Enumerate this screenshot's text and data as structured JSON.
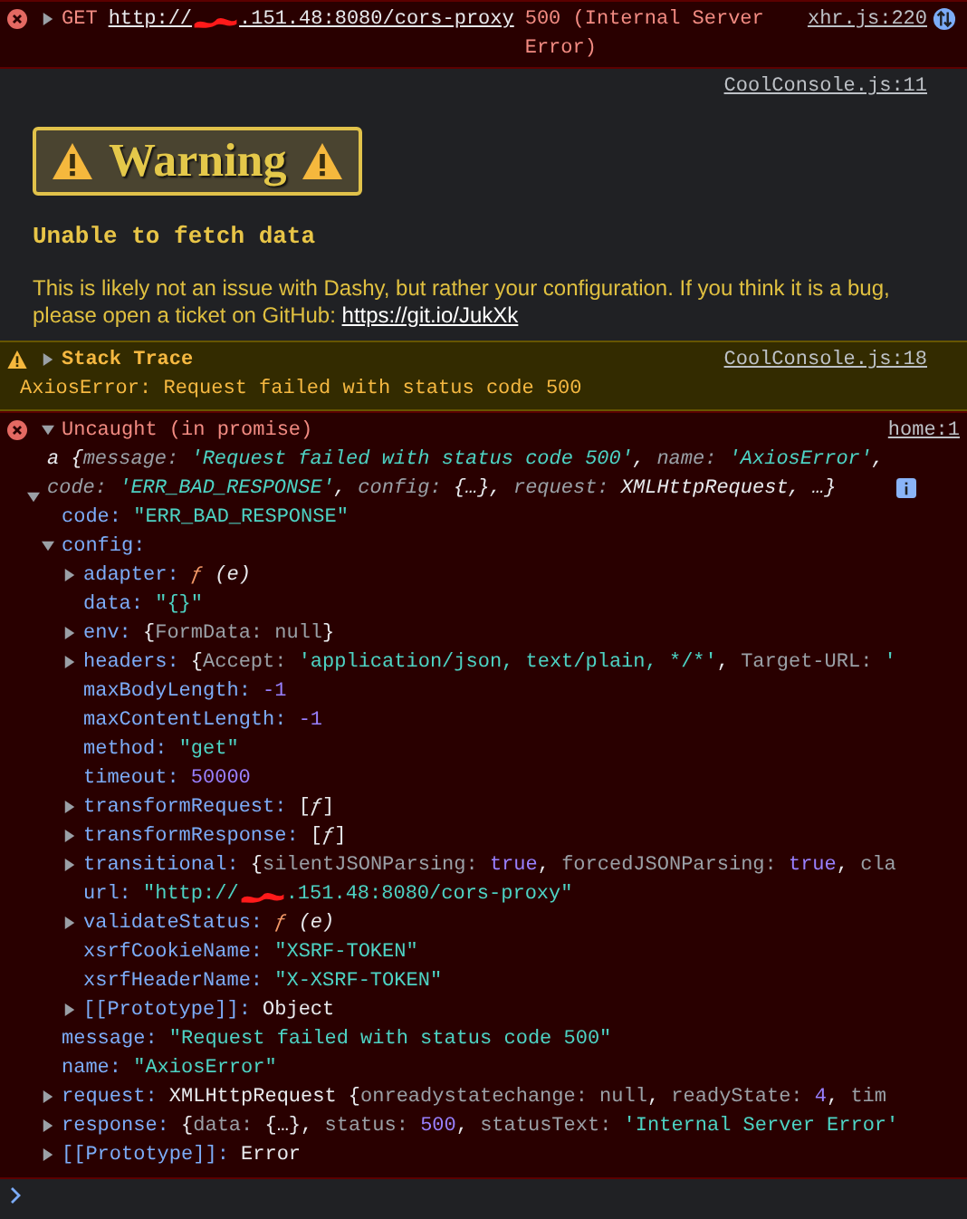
{
  "network_error": {
    "expanded": false,
    "method": "GET",
    "url_start": "http://",
    "url_end": ".151.48:8080/cors-proxy",
    "status": "500 (Internal Server Error)",
    "source": "xhr.js:220"
  },
  "styled_log": {
    "source": "CoolConsole.js:11",
    "badge": "Warning",
    "heading": "Unable to fetch data",
    "body": "This is likely not an issue with Dashy, but rather your configuration. If you think it is a bug, please open a ticket on GitHub:",
    "link": "https://git.io/JukXk"
  },
  "stack_warning": {
    "expanded": false,
    "title": "Stack Trace",
    "source": "CoolConsole.js:18",
    "message": "AxiosError: Request failed with status code 500"
  },
  "uncaught": {
    "expanded": true,
    "title": "Uncaught (in promise)",
    "source": "home:1",
    "preview": [
      {
        "kind": "punct",
        "text": "a {"
      },
      {
        "kind": "prop",
        "text": "message: "
      },
      {
        "kind": "string",
        "text": "'Request failed with status code 500'"
      },
      {
        "kind": "punct",
        "text": ", "
      },
      {
        "kind": "prop",
        "text": "name: "
      },
      {
        "kind": "string",
        "text": "'AxiosError'"
      },
      {
        "kind": "punct",
        "text": ", "
      },
      {
        "kind": "prop",
        "text": "code: "
      },
      {
        "kind": "string",
        "text": "'ERR_BAD_RESPONSE'"
      },
      {
        "kind": "punct",
        "text": ", "
      },
      {
        "kind": "prop",
        "text": "config: "
      },
      {
        "kind": "punct",
        "text": "{…}, "
      },
      {
        "kind": "prop",
        "text": "request: "
      },
      {
        "kind": "punct",
        "text": "XMLHttpRequest, …}"
      }
    ],
    "children": [
      {
        "key": "code:",
        "value": [
          {
            "kind": "string",
            "text": "\"ERR_BAD_RESPONSE\""
          }
        ]
      },
      {
        "key": "config:",
        "expanded": true,
        "children": [
          {
            "key": "adapter:",
            "expanded": false,
            "value": [
              {
                "kind": "func",
                "text": "ƒ"
              },
              {
                "kind": "param",
                "text": " (e)"
              }
            ]
          },
          {
            "key": "data:",
            "value": [
              {
                "kind": "string",
                "text": "\"{}\""
              }
            ]
          },
          {
            "key": "env:",
            "expanded": false,
            "value": [
              {
                "kind": "punct",
                "text": "{"
              },
              {
                "kind": "prop",
                "text": "FormData: null"
              },
              {
                "kind": "punct",
                "text": "}"
              }
            ]
          },
          {
            "key": "headers:",
            "expanded": false,
            "value": [
              {
                "kind": "punct",
                "text": "{"
              },
              {
                "kind": "prop",
                "text": "Accept: "
              },
              {
                "kind": "string",
                "text": "'application/json, text/plain, */*'"
              },
              {
                "kind": "punct",
                "text": ", "
              },
              {
                "kind": "prop",
                "text": "Target-URL: "
              },
              {
                "kind": "string",
                "text": "'"
              }
            ]
          },
          {
            "key": "maxBodyLength:",
            "value": [
              {
                "kind": "number",
                "text": "-1"
              }
            ]
          },
          {
            "key": "maxContentLength:",
            "value": [
              {
                "kind": "number",
                "text": "-1"
              }
            ]
          },
          {
            "key": "method:",
            "value": [
              {
                "kind": "string",
                "text": "\"get\""
              }
            ]
          },
          {
            "key": "timeout:",
            "value": [
              {
                "kind": "number",
                "text": "50000"
              }
            ]
          },
          {
            "key": "transformRequest:",
            "expanded": false,
            "value": [
              {
                "kind": "punct",
                "text": "["
              },
              {
                "kind": "param",
                "text": "ƒ"
              },
              {
                "kind": "punct",
                "text": "]"
              }
            ]
          },
          {
            "key": "transformResponse:",
            "expanded": false,
            "value": [
              {
                "kind": "punct",
                "text": "["
              },
              {
                "kind": "param",
                "text": "ƒ"
              },
              {
                "kind": "punct",
                "text": "]"
              }
            ]
          },
          {
            "key": "transitional:",
            "expanded": false,
            "value": [
              {
                "kind": "punct",
                "text": "{"
              },
              {
                "kind": "prop",
                "text": "silentJSONParsing: "
              },
              {
                "kind": "number",
                "text": "true"
              },
              {
                "kind": "punct",
                "text": ", "
              },
              {
                "kind": "prop",
                "text": "forcedJSONParsing: "
              },
              {
                "kind": "number",
                "text": "true"
              },
              {
                "kind": "punct",
                "text": ", "
              },
              {
                "kind": "prop",
                "text": "cla"
              }
            ]
          },
          {
            "key": "url:",
            "value": [
              {
                "kind": "string",
                "text": "\"http://"
              },
              {
                "kind": "redaction"
              },
              {
                "kind": "string",
                "text": ".151.48:8080/cors-proxy\""
              }
            ]
          },
          {
            "key": "validateStatus:",
            "expanded": false,
            "value": [
              {
                "kind": "func",
                "text": "ƒ"
              },
              {
                "kind": "param",
                "text": " (e)"
              }
            ]
          },
          {
            "key": "xsrfCookieName:",
            "value": [
              {
                "kind": "string",
                "text": "\"XSRF-TOKEN\""
              }
            ]
          },
          {
            "key": "xsrfHeaderName:",
            "value": [
              {
                "kind": "string",
                "text": "\"X-XSRF-TOKEN\""
              }
            ]
          },
          {
            "key": "[[Prototype]]:",
            "expanded": false,
            "value": [
              {
                "kind": "punct",
                "text": "Object"
              }
            ]
          }
        ]
      },
      {
        "key": "message:",
        "value": [
          {
            "kind": "string",
            "text": "\"Request failed with status code 500\""
          }
        ]
      },
      {
        "key": "name:",
        "value": [
          {
            "kind": "string",
            "text": "\"AxiosError\""
          }
        ]
      },
      {
        "key": "request:",
        "expanded": false,
        "value": [
          {
            "kind": "punct",
            "text": "XMLHttpRequest {"
          },
          {
            "kind": "prop",
            "text": "onreadystatechange: null"
          },
          {
            "kind": "punct",
            "text": ", "
          },
          {
            "kind": "prop",
            "text": "readyState: "
          },
          {
            "kind": "number",
            "text": "4"
          },
          {
            "kind": "punct",
            "text": ", "
          },
          {
            "kind": "prop",
            "text": "tim"
          }
        ]
      },
      {
        "key": "response:",
        "expanded": false,
        "value": [
          {
            "kind": "punct",
            "text": "{"
          },
          {
            "kind": "prop",
            "text": "data: "
          },
          {
            "kind": "punct",
            "text": "{…}, "
          },
          {
            "kind": "prop",
            "text": "status: "
          },
          {
            "kind": "number",
            "text": "500"
          },
          {
            "kind": "punct",
            "text": ", "
          },
          {
            "kind": "prop",
            "text": "statusText: "
          },
          {
            "kind": "string",
            "text": "'Internal Server Error'"
          }
        ]
      },
      {
        "key": "[[Prototype]]:",
        "expanded": false,
        "value": [
          {
            "kind": "punct",
            "text": "Error"
          }
        ]
      }
    ]
  }
}
